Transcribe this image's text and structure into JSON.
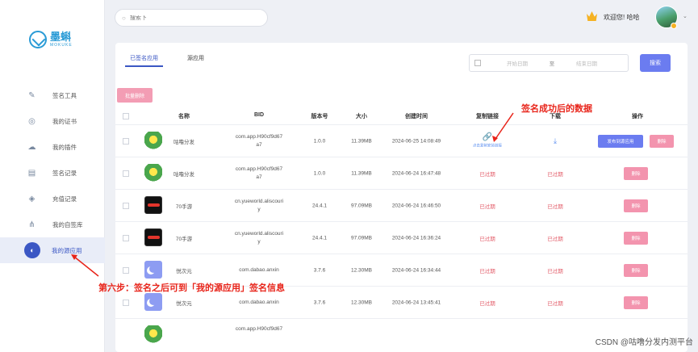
{
  "sidebar": {
    "logo": {
      "name": "墨蝌",
      "sub": "MOKUKE"
    },
    "items": [
      {
        "label": "签名工具",
        "icon": "pen-icon"
      },
      {
        "label": "我的证书",
        "icon": "certificate-icon"
      },
      {
        "label": "我的插件",
        "icon": "plugin-icon"
      },
      {
        "label": "签名记录",
        "icon": "record-icon"
      },
      {
        "label": "充值记录",
        "icon": "recharge-icon"
      },
      {
        "label": "我的自签库",
        "icon": "share-icon"
      },
      {
        "label": "我的源应用",
        "icon": "app-icon",
        "active": true
      }
    ]
  },
  "topbar": {
    "search_placeholder": "搜索下",
    "welcome": "欢迎您! 哈哈"
  },
  "tabs": [
    {
      "label": "已签名应用",
      "active": true
    },
    {
      "label": "源应用",
      "active": false
    }
  ],
  "filter": {
    "start_placeholder": "开始日期",
    "separator": "至",
    "end_placeholder": "结束日期",
    "search_label": "搜索"
  },
  "bulk_delete_label": "批量删除",
  "table": {
    "headers": [
      "名称",
      "BID",
      "版本号",
      "大小",
      "创建时间",
      "复制链接",
      "下载",
      "操作"
    ],
    "rows": [
      {
        "icon": "green",
        "name": "咕噜分发",
        "bid1": "com.app.H90cf9d67",
        "bid2": "a7",
        "version": "1.0.0",
        "size": "11.39MB",
        "created": "2024-06-25 14:08:49",
        "link": "点击复制安装链接",
        "download": "download",
        "actions": [
          "发布到源应用",
          "删除"
        ]
      },
      {
        "icon": "green",
        "name": "咕噜分发",
        "bid1": "com.app.H90cf9d67",
        "bid2": "a7",
        "version": "1.0.0",
        "size": "11.39MB",
        "created": "2024-06-24 16:47:48",
        "link": "已过期",
        "download": "已过期",
        "actions": [
          "删除"
        ]
      },
      {
        "icon": "dark",
        "name": "70手游",
        "bid1": "cn.yueworld.aliscouri",
        "bid2": "y",
        "version": "24.4.1",
        "size": "97.09MB",
        "created": "2024-06-24 16:46:50",
        "link": "已过期",
        "download": "已过期",
        "actions": [
          "删除"
        ]
      },
      {
        "icon": "dark",
        "name": "70手游",
        "bid1": "cn.yueworld.aliscouri",
        "bid2": "y",
        "version": "24.4.1",
        "size": "97.09MB",
        "created": "2024-06-24 16:36:24",
        "link": "已过期",
        "download": "已过期",
        "actions": [
          "删除"
        ]
      },
      {
        "icon": "moon",
        "name": "悦次元",
        "bid1": "com.dabao.anxin",
        "bid2": "",
        "version": "3.7.6",
        "size": "12.30MB",
        "created": "2024-06-24 16:34:44",
        "link": "已过期",
        "download": "已过期",
        "actions": [
          "删除"
        ]
      },
      {
        "icon": "moon",
        "name": "悦次元",
        "bid1": "com.dabao.anxin",
        "bid2": "",
        "version": "3.7.6",
        "size": "12.30MB",
        "created": "2024-06-24 13:45:41",
        "link": "已过期",
        "download": "已过期",
        "actions": [
          "删除"
        ]
      },
      {
        "icon": "green",
        "name": "",
        "bid1": "com.app.H90cf9d67",
        "bid2": "",
        "version": "",
        "size": "",
        "created": "",
        "link": "",
        "download": "",
        "actions": []
      }
    ]
  },
  "annotations": {
    "top": "签名成功后的数据",
    "bottom": "第六步：签名之后可到「我的源应用」签名信息"
  },
  "watermark": "CSDN @咕噜分发内测平台",
  "colors": {
    "accent": "#3b57c4",
    "primary_btn": "#6b7cf0",
    "delete_btn": "#f394ae",
    "expired": "#e35d6a",
    "annotation": "#e8241a"
  }
}
